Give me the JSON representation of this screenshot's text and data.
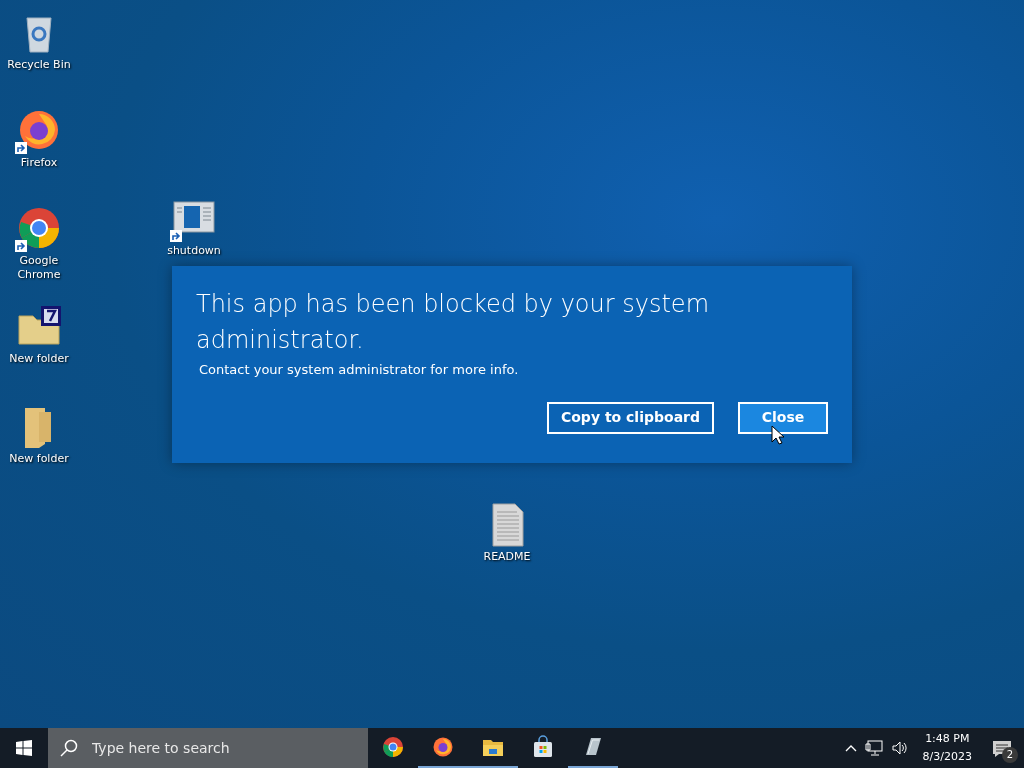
{
  "desktop_icons": [
    {
      "kind": "recycle",
      "label": "Recycle Bin",
      "shortcut": false
    },
    {
      "kind": "firefox",
      "label": "Firefox",
      "shortcut": true
    },
    {
      "kind": "chrome",
      "label": "Google Chrome",
      "shortcut": true
    },
    {
      "kind": "shutdown",
      "label": "shutdown",
      "shortcut": true
    },
    {
      "kind": "archive-folder",
      "label": "New folder",
      "shortcut": false
    },
    {
      "kind": "folder",
      "label": "New folder",
      "shortcut": false
    },
    {
      "kind": "document",
      "label": "README",
      "shortcut": false
    }
  ],
  "dialog": {
    "title": "This app has been blocked by your system administrator.",
    "message": "Contact your system administrator for more info.",
    "buttons": [
      {
        "label": "Copy to clipboard",
        "kind": "secondary"
      },
      {
        "label": "Close",
        "kind": "primary"
      }
    ]
  },
  "taskbar": {
    "search": {
      "placeholder": "Type here to search"
    },
    "apps": [
      {
        "kind": "chrome",
        "running": false
      },
      {
        "kind": "firefox",
        "running": true
      },
      {
        "kind": "explorer",
        "running": true
      },
      {
        "kind": "store",
        "running": false
      },
      {
        "kind": "notepad",
        "running": true
      }
    ],
    "clock": {
      "time": "1:48 PM",
      "date": "8/3/2023"
    },
    "notifications": {
      "count": "2"
    }
  }
}
